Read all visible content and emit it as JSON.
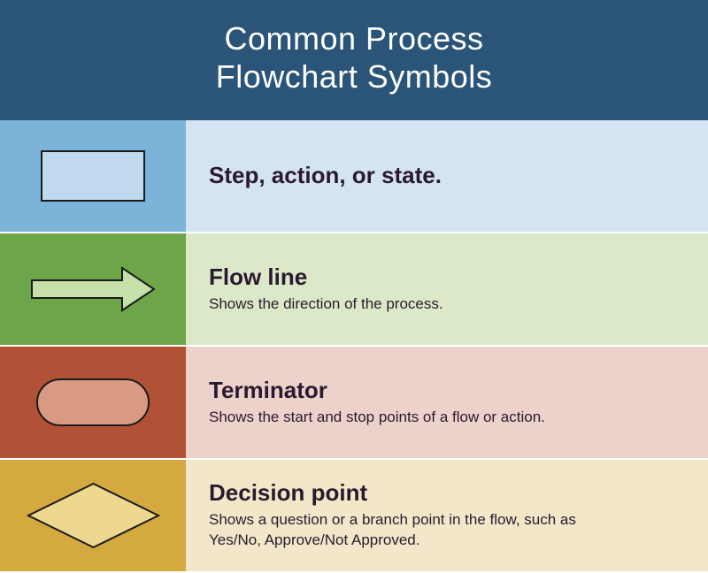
{
  "header": {
    "line1": "Common Process",
    "line2": "Flowchart Symbols"
  },
  "rows": [
    {
      "label": "Step, action, or state.",
      "desc": ""
    },
    {
      "label": "Flow line",
      "desc": "Shows the direction of the process."
    },
    {
      "label": "Terminator",
      "desc": "Shows the start and stop points of a flow or action."
    },
    {
      "label": "Decision point",
      "desc": "Shows a question or a branch point in the flow, such as Yes/No, Approve/Not Approved."
    }
  ]
}
